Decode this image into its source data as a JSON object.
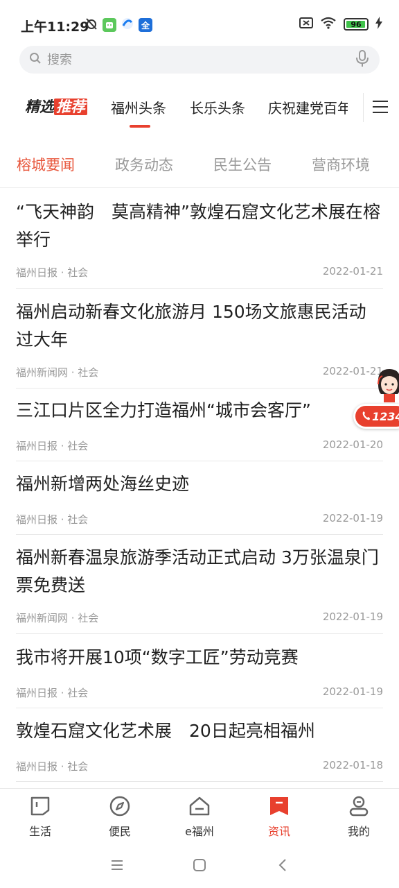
{
  "status_bar": {
    "time": "上午11:29",
    "battery_level": 96,
    "battery_text": "96",
    "app_badge_text": "全"
  },
  "search": {
    "placeholder": "搜索"
  },
  "channels": {
    "brand_part1": "精选",
    "brand_part2": "推荐",
    "items": [
      {
        "label": "福州头条",
        "active": true
      },
      {
        "label": "长乐头条",
        "active": false
      },
      {
        "label": "庆祝建党百年",
        "active": false
      }
    ]
  },
  "sub_tabs": [
    {
      "label": "榕城要闻",
      "active": true
    },
    {
      "label": "政务动态",
      "active": false
    },
    {
      "label": "民生公告",
      "active": false
    },
    {
      "label": "营商环境",
      "active": false
    }
  ],
  "news": [
    {
      "title": "“飞天神韵　莫高精神”敦煌石窟文化艺术展在榕举行",
      "source": "福州日报 · 社会",
      "date": "2022-01-21"
    },
    {
      "title": "福州启动新春文化旅游月 150场文旅惠民活动过大年",
      "source": "福州新闻网 · 社会",
      "date": "2022-01-21"
    },
    {
      "title": "三江口片区全力打造福州“城市会客厅”",
      "source": "福州日报 · 社会",
      "date": "2022-01-20"
    },
    {
      "title": "福州新增两处海丝史迹",
      "source": "福州日报 · 社会",
      "date": "2022-01-19"
    },
    {
      "title": "福州新春温泉旅游季活动正式启动 3万张温泉门票免费送",
      "source": "福州新闻网 · 社会",
      "date": "2022-01-19"
    },
    {
      "title": "我市将开展10项“数字工匠”劳动竞赛",
      "source": "福州日报 · 社会",
      "date": "2022-01-19"
    },
    {
      "title": "敦煌石窟文化艺术展　20日起亮相福州",
      "source": "福州日报 · 社会",
      "date": "2022-01-18"
    }
  ],
  "assistant": {
    "pill_text": "1234"
  },
  "bottom_nav": [
    {
      "label": "生活",
      "icon": "life-icon",
      "active": false
    },
    {
      "label": "便民",
      "icon": "compass-icon",
      "active": false
    },
    {
      "label": "e福州",
      "icon": "home-icon",
      "active": false
    },
    {
      "label": "资讯",
      "icon": "news-icon",
      "active": true
    },
    {
      "label": "我的",
      "icon": "profile-icon",
      "active": false
    }
  ],
  "colors": {
    "accent": "#e8402e",
    "sub_tab_active": "#e8583e",
    "muted_text": "#9a9a9a"
  }
}
